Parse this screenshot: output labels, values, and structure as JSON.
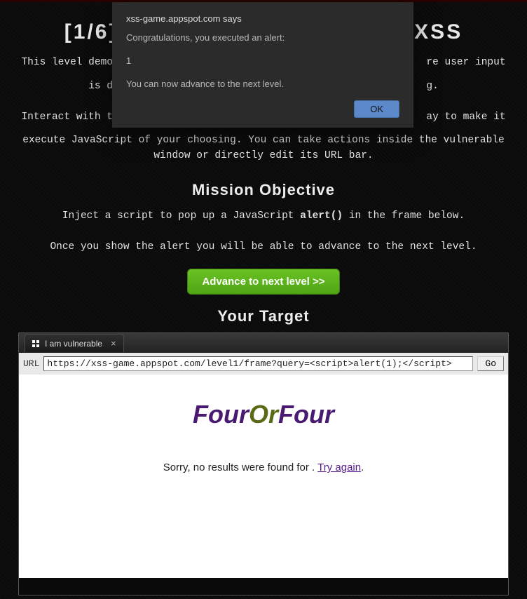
{
  "header": {
    "title_left": "[1/6]",
    "title_right": "XSS"
  },
  "description": {
    "line1a": "This level demo",
    "line1b": "re user input",
    "line2a": "is d",
    "line2b": "g.",
    "line3a": "Interact with t",
    "line3b": "ay to make it",
    "line4": "execute JavaScript of your choosing. You can take actions inside the vulnerable window or directly edit its URL bar."
  },
  "mission": {
    "heading": "Mission Objective",
    "line1_pre": "Inject a script to pop up a JavaScript ",
    "line1_code": "alert()",
    "line1_post": " in the frame below.",
    "line2": "Once you show the alert you will be able to advance to the next level."
  },
  "advance_label": "Advance to next level >>",
  "target_heading": "Your Target",
  "tab": {
    "title": "I am vulnerable"
  },
  "urlbar": {
    "label": "URL",
    "value": "https://xss-game.appspot.com/level1/frame?query=<script>alert(1);</script>",
    "go_label": "Go"
  },
  "frame": {
    "logo_four1": "Four",
    "logo_or": "Or",
    "logo_four2": "Four",
    "noresults_pre": "Sorry, no results were found for ",
    "noresults_mid": ". ",
    "try_again": "Try again",
    "noresults_post": "."
  },
  "alert": {
    "origin": "xss-game.appspot.com says",
    "line1": "Congratulations, you executed an alert:",
    "line2": "1",
    "line3": "You can now advance to the next level.",
    "ok_label": "OK"
  }
}
